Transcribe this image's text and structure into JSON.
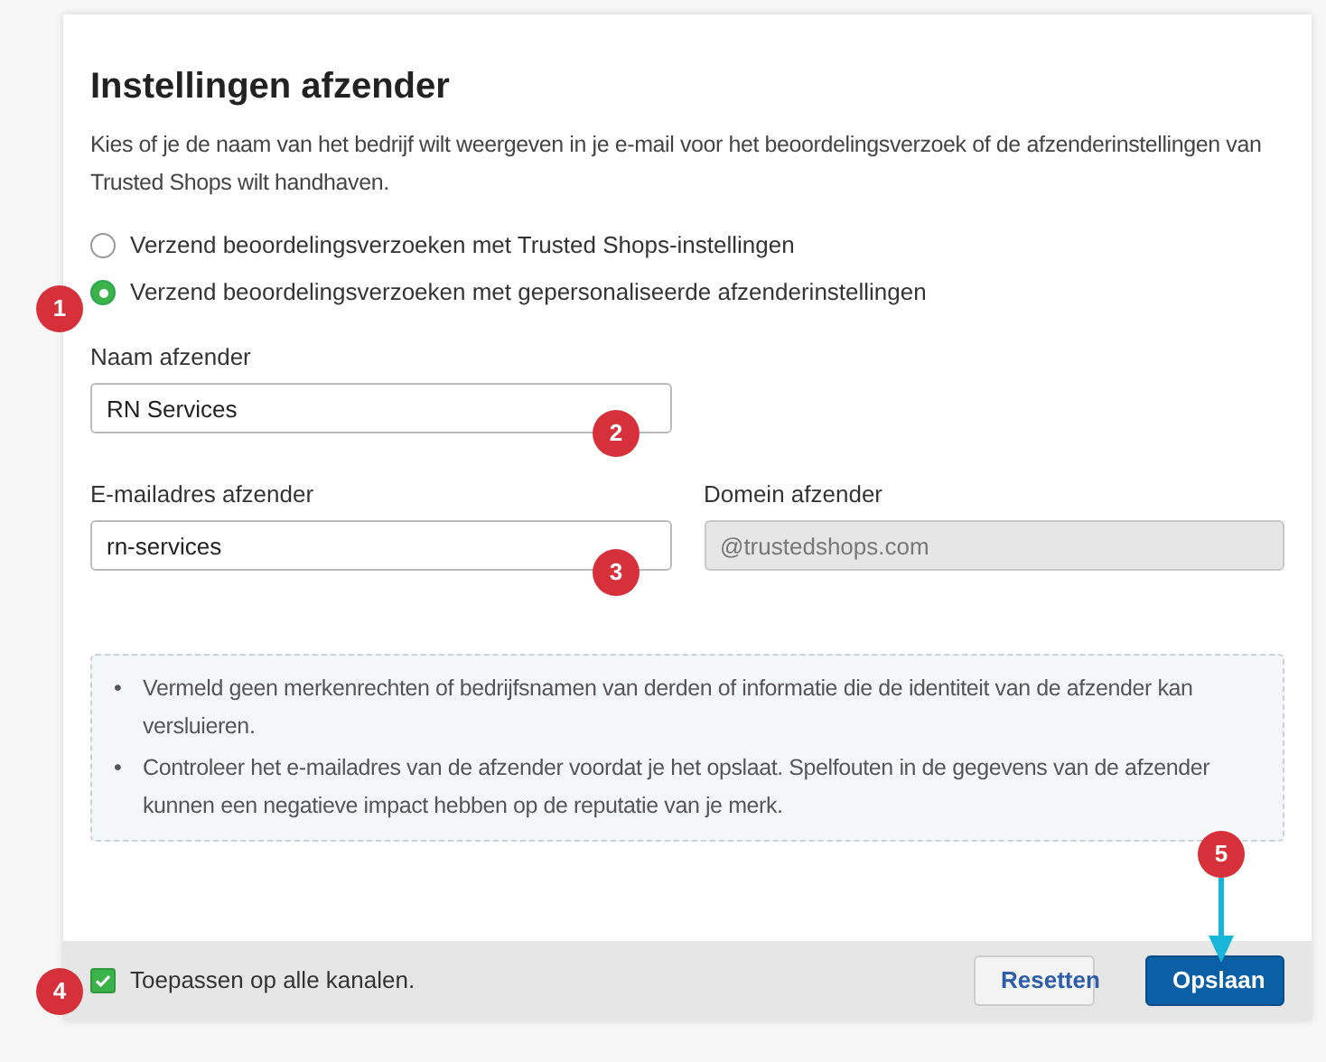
{
  "title": "Instellingen afzender",
  "intro": "Kies of je de naam van het bedrijf wilt weergeven in je e-mail voor het beoordelingsverzoek of de afzenderinstellingen van Trusted Shops wilt handhaven.",
  "sender_options": [
    {
      "label": "Verzend beoordelingsverzoeken met Trusted Shops-instellingen",
      "selected": false
    },
    {
      "label": "Verzend beoordelingsverzoeken met gepersonaliseerde afzenderinstellingen",
      "selected": true
    }
  ],
  "field_rows": [
    [
      {
        "label": "Naam afzender",
        "value": "RN Services",
        "disabled": false
      }
    ],
    [
      {
        "label": "E-mailadres afzender",
        "value": "rn-services",
        "disabled": false
      },
      {
        "label": "Domein afzender",
        "value": "@trustedshops.com",
        "disabled": true
      }
    ]
  ],
  "notes": [
    {
      "bullet": "•",
      "text": "Vermeld geen merkenrechten of bedrijfsnamen van derden of informatie die de identiteit van de afzender kan versluieren."
    },
    {
      "bullet": "•",
      "text": "Controleer het e-mailadres van de afzender voordat je het opslaat. Spelfouten in de gegevens van de afzender kunnen een negatieve impact hebben op de reputatie van je merk."
    }
  ],
  "footer": {
    "apply_all": {
      "label": "Toepassen op alle kanalen.",
      "checked": true
    },
    "buttons": [
      {
        "label": "Resetten",
        "kind": "secondary"
      },
      {
        "label": "Opslaan",
        "kind": "primary"
      }
    ]
  },
  "callouts": [
    "1",
    "2",
    "3",
    "4",
    "5"
  ]
}
